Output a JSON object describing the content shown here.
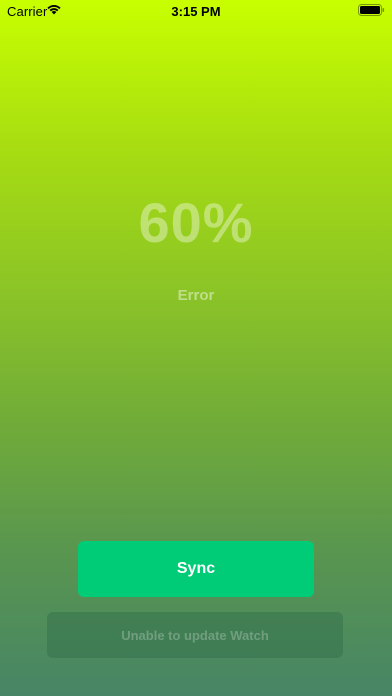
{
  "status_bar": {
    "carrier": "Carrier",
    "time": "3:15 PM",
    "icons": [
      "wifi-icon",
      "battery-icon"
    ]
  },
  "main": {
    "percent": "60%",
    "status": "Error"
  },
  "actions": {
    "sync_label": "Sync",
    "update_label": "Unable to update Watch"
  },
  "colors": {
    "gradient_top": "#c8ff00",
    "gradient_bottom": "#478566",
    "sync_button": "#00cc77"
  }
}
